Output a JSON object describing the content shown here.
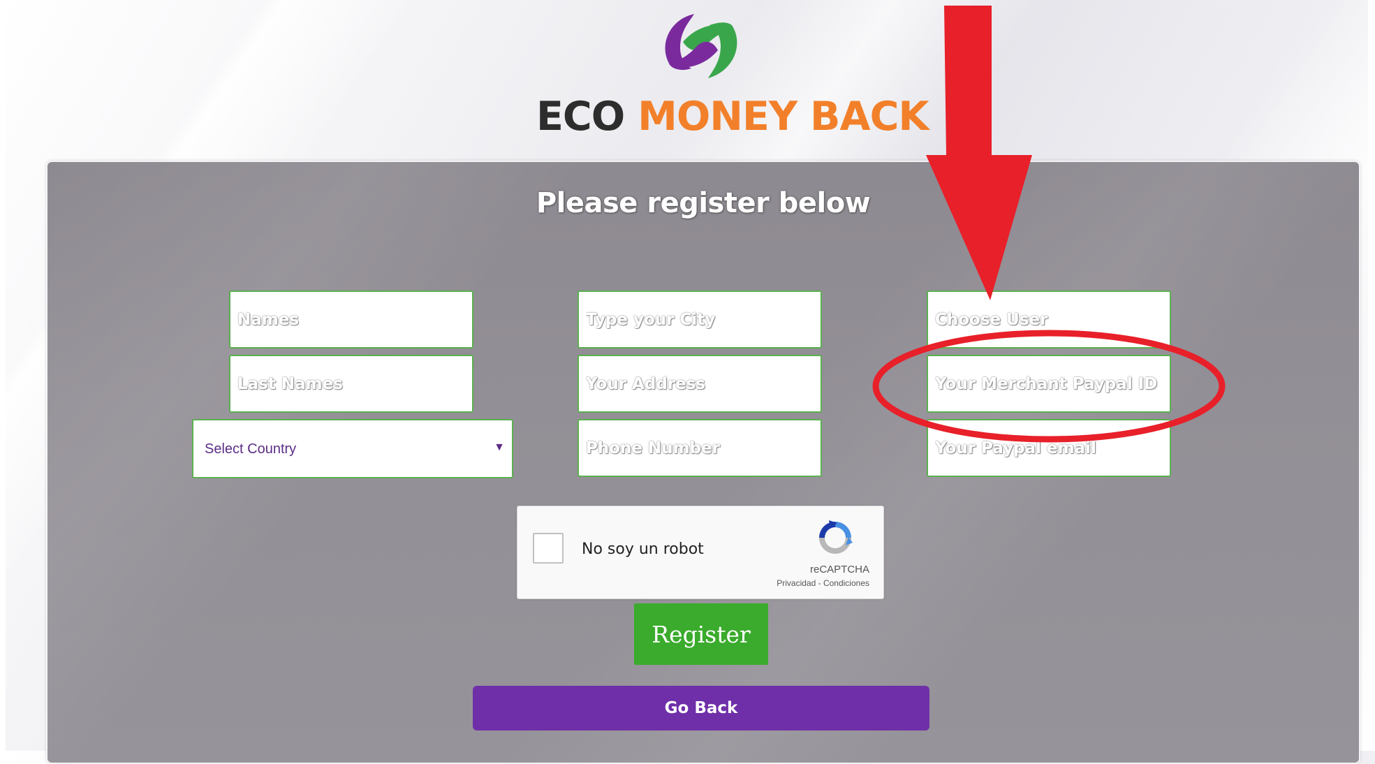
{
  "brand": {
    "name_part1": "ECO",
    "name_part2": "MONEY BACK",
    "logo_icon": "eco-swirl-logo-icon"
  },
  "form": {
    "title": "Please register below",
    "names_placeholder": "Names",
    "last_names_placeholder": "Last Names",
    "country_select": "Select Country",
    "city_placeholder": "Type your City",
    "address_placeholder": "Your Address",
    "phone_placeholder": "Phone Number",
    "user_placeholder": "Choose User",
    "merchant_paypal_placeholder": "Your Merchant Paypal ID",
    "paypal_email_placeholder": "Your Paypal email"
  },
  "captcha": {
    "label": "No soy un robot",
    "brand": "reCAPTCHA",
    "links": "Privacidad - Condiciones",
    "icon": "recaptcha-icon"
  },
  "buttons": {
    "register": "Register",
    "go_back": "Go Back"
  },
  "annotation": {
    "arrow_icon": "red-arrow-icon",
    "highlight": "red-ellipse-highlight"
  },
  "colors": {
    "eco_text": "#2d2d2d",
    "money_back_text": "#f2802a",
    "panel_bg": "#938f96",
    "field_border": "#5bb04f",
    "register_bg": "#3aab2c",
    "go_back_bg": "#6f2fa8",
    "annotation_red": "#e8202a",
    "select_text": "#5b2d86"
  }
}
